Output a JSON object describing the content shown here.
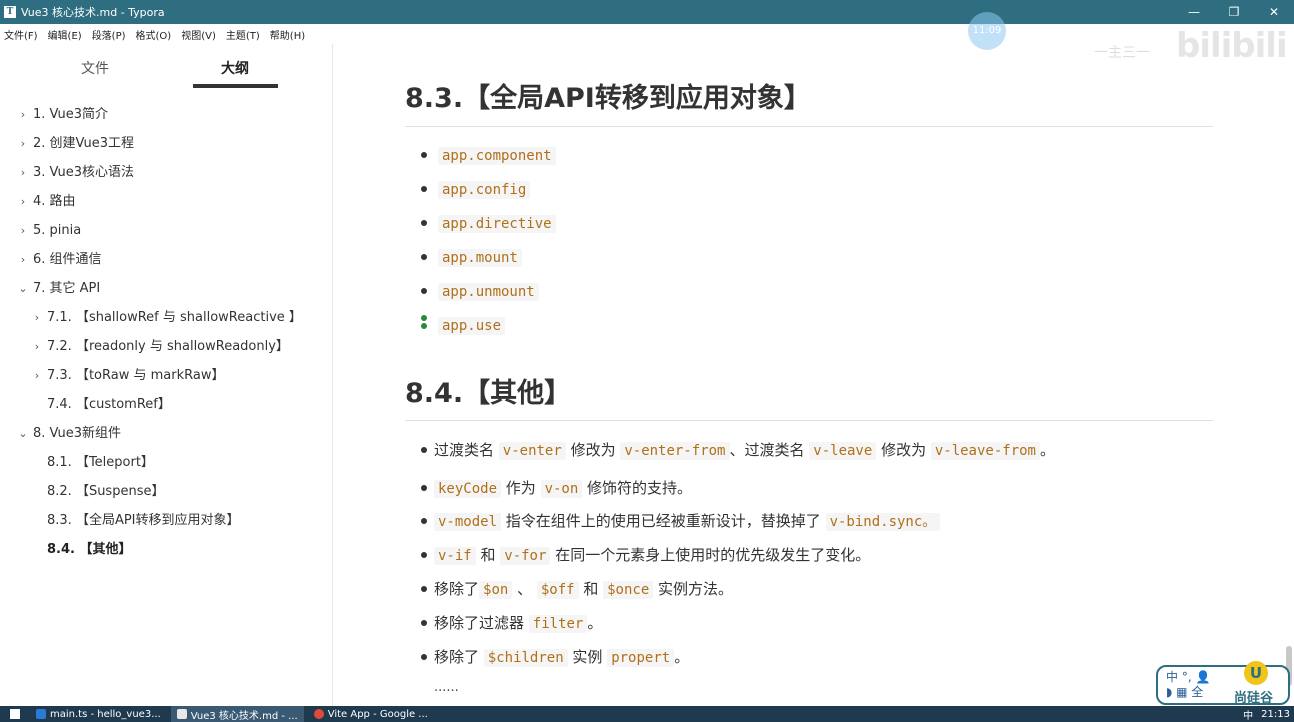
{
  "window": {
    "title": "Vue3 核心技术.md - Typora",
    "buttons": [
      "—",
      "❐",
      "✕"
    ]
  },
  "menubar": [
    "文件(F)",
    "编辑(E)",
    "段落(P)",
    "格式(O)",
    "视图(V)",
    "主题(T)",
    "帮助(H)"
  ],
  "sidebar": {
    "tabs": {
      "files": "文件",
      "outline": "大纲"
    },
    "items": [
      {
        "label": "1. Vue3简介",
        "chev": "›"
      },
      {
        "label": "2. 创建Vue3工程",
        "chev": "›"
      },
      {
        "label": "3. Vue3核心语法",
        "chev": "›"
      },
      {
        "label": "4. 路由",
        "chev": "›"
      },
      {
        "label": "5. pinia",
        "chev": "›"
      },
      {
        "label": "6. 组件通信",
        "chev": "›"
      },
      {
        "label": "7. 其它 API",
        "chev": "⌄"
      },
      {
        "label": "7.1. 【shallowRef 与 shallowReactive 】",
        "chev": "›"
      },
      {
        "label": "7.2. 【readonly 与 shallowReadonly】",
        "chev": "›"
      },
      {
        "label": "7.3. 【toRaw 与 markRaw】",
        "chev": "›"
      },
      {
        "label": "7.4. 【customRef】",
        "chev": ""
      },
      {
        "label": "8. Vue3新组件",
        "chev": "⌄"
      },
      {
        "label": "8.1. 【Teleport】",
        "chev": ""
      },
      {
        "label": "8.2. 【Suspense】",
        "chev": ""
      },
      {
        "label": "8.3. 【全局API转移到应用对象】",
        "chev": ""
      },
      {
        "label": "8.4. 【其他】",
        "chev": ""
      }
    ]
  },
  "content": {
    "section_83": {
      "heading": "8.3.【全局API转移到应用对象】",
      "items": [
        "app.component",
        "app.config",
        "app.directive",
        "app.mount",
        "app.unmount",
        "app.use"
      ]
    },
    "section_84": {
      "heading": "8.4.【其他】",
      "items": [
        {
          "t1": "过渡类名 ",
          "c1": "v-enter",
          "t2": " 修改为 ",
          "c2": "v-enter-from",
          "t3": "、过渡类名 ",
          "c3": "v-leave",
          "t4": " 修改为 ",
          "c4": "v-leave-from",
          "t5": "。"
        },
        {
          "c1": "keyCode",
          "t1": " 作为 ",
          "c2": "v-on",
          "t2": " 修饰符的支持。"
        },
        {
          "c1": "v-model",
          "t1": " 指令在组件上的使用已经被重新设计，替换掉了 ",
          "c2": "v-bind.sync。"
        },
        {
          "c1": "v-if",
          "t1": " 和 ",
          "c2": "v-for",
          "t2": " 在同一个元素身上使用时的优先级发生了变化。"
        },
        {
          "t1": "移除了",
          "c1": "$on",
          "t2": " 、 ",
          "c2": "$off",
          "t3": " 和 ",
          "c3": "$once",
          "t4": " 实例方法。"
        },
        {
          "t1": "移除了过滤器 ",
          "c1": "filter",
          "t2": "。"
        },
        {
          "t1": "移除了 ",
          "c1": "$children",
          "t2": " 实例 ",
          "c2": "propert",
          "t3": "。"
        }
      ],
      "ellipsis": "......"
    }
  },
  "overlays": {
    "clock": "11:09",
    "watermark": "bilibili",
    "watermark_small": "一主三一"
  },
  "ime": {
    "line1": "中 °, 👤",
    "line2": "◗ ▦ 全",
    "brand": "尚硅谷",
    "brand_logo": "U"
  },
  "taskbar": {
    "tasks": [
      {
        "label": "main.ts - hello_vue3...",
        "color": "#2b7bd6"
      },
      {
        "label": "Vue3 核心技术.md - ...",
        "color": "#e8e8e8"
      },
      {
        "label": "Vite App - Google ...",
        "color": "#e04a3a"
      }
    ],
    "tray_lang": "中",
    "time": "21:13"
  },
  "colors": {
    "titlebar": "#2e6e80",
    "code_text": "#b0701a",
    "taskbar": "#1f3a4f"
  }
}
